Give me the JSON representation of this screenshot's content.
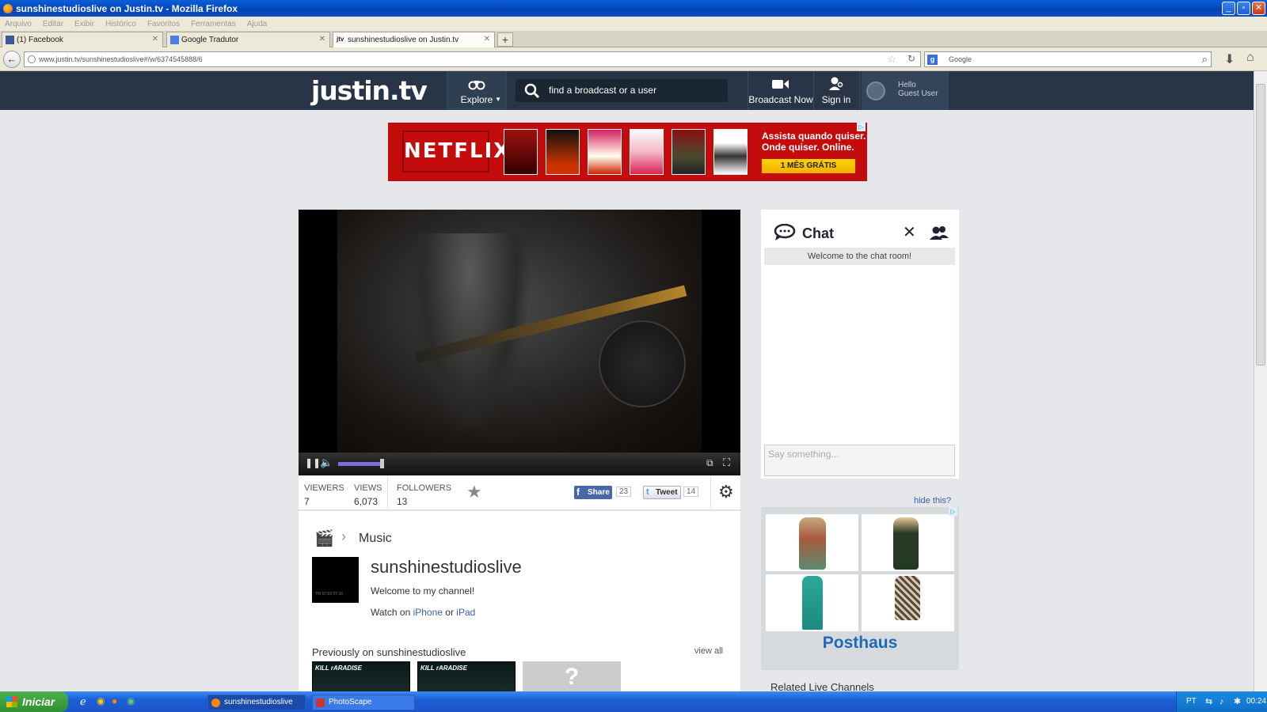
{
  "window": {
    "title": "sunshinestudioslive on Justin.tv - Mozilla Firefox"
  },
  "menu": [
    "Arquivo",
    "Editar",
    "Exibir",
    "Histórico",
    "Favoritos",
    "Ferramentas",
    "Ajuda"
  ],
  "tabs": [
    {
      "label": "(1) Facebook"
    },
    {
      "label": "Google Tradutor"
    },
    {
      "label": "sunshinestudioslive on Justin.tv"
    }
  ],
  "nav": {
    "url": "www.justin.tv/sunshinestudioslive#/w/6374545888/6",
    "search_placeholder": "Google"
  },
  "site": {
    "logo": "justin.tv",
    "explore": "Explore",
    "search_placeholder": "find a broadcast or a user",
    "broadcast": "Broadcast Now",
    "signin": "Sign in",
    "hello": "Hello",
    "guest": "Guest User"
  },
  "ad": {
    "brand": "NETFLIX",
    "line1": "Assista quando quiser.",
    "line2": "Onde quiser. Online.",
    "cta": "1 MÊS GRÁTIS"
  },
  "stats": {
    "viewers_label": "VIEWERS",
    "viewers": "7",
    "views_label": "VIEWS",
    "views": "6,073",
    "followers_label": "FOLLOWERS",
    "followers": "13",
    "share_label": "Share",
    "share_count": "23",
    "tweet_label": "Tweet",
    "tweet_count": "14"
  },
  "channel": {
    "category": "Music",
    "name": "sunshinestudioslive",
    "welcome": "Welcome to my channel!",
    "watch_prefix": "Watch on ",
    "iphone": "iPhone",
    "or": " or ",
    "ipad": "iPad",
    "previously": "Previously on sunshinestudioslive",
    "view_all": "view all"
  },
  "chat": {
    "title": "Chat",
    "welcome": "Welcome to the chat room!",
    "placeholder": "Say something...",
    "hide": "hide this?",
    "ad_brand": "Posthaus",
    "related": "Related Live Channels"
  },
  "taskbar": {
    "start": "Iniciar",
    "task1": "sunshinestudioslive o...",
    "task2": "PhotoScape",
    "lang": "PT",
    "clock": "00:24"
  },
  "colors": {
    "header": "#273546",
    "netflix": "#c40c0c",
    "taskbar": "#1b5fd6"
  }
}
